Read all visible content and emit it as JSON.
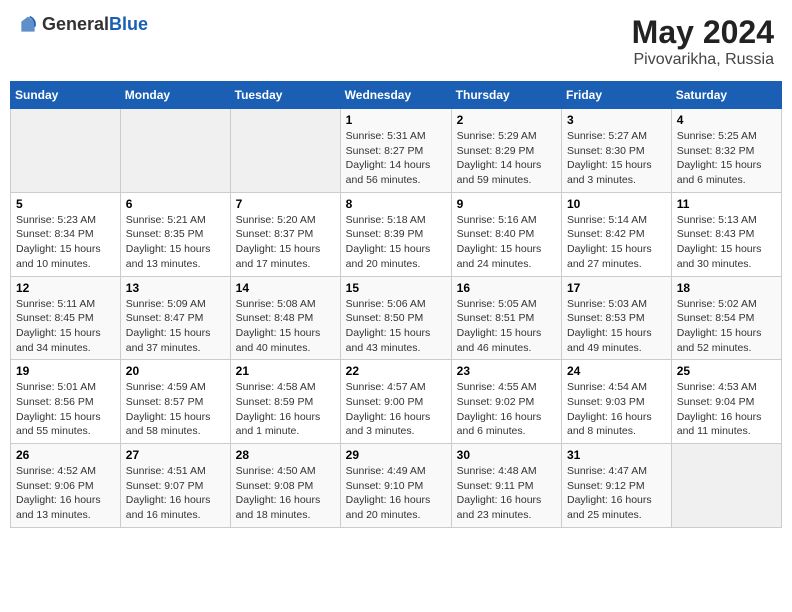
{
  "header": {
    "logo_general": "General",
    "logo_blue": "Blue",
    "title": "May 2024",
    "location": "Pivovarikha, Russia"
  },
  "weekdays": [
    "Sunday",
    "Monday",
    "Tuesday",
    "Wednesday",
    "Thursday",
    "Friday",
    "Saturday"
  ],
  "weeks": [
    [
      {
        "day": "",
        "info": ""
      },
      {
        "day": "",
        "info": ""
      },
      {
        "day": "",
        "info": ""
      },
      {
        "day": "1",
        "info": "Sunrise: 5:31 AM\nSunset: 8:27 PM\nDaylight: 14 hours\nand 56 minutes."
      },
      {
        "day": "2",
        "info": "Sunrise: 5:29 AM\nSunset: 8:29 PM\nDaylight: 14 hours\nand 59 minutes."
      },
      {
        "day": "3",
        "info": "Sunrise: 5:27 AM\nSunset: 8:30 PM\nDaylight: 15 hours\nand 3 minutes."
      },
      {
        "day": "4",
        "info": "Sunrise: 5:25 AM\nSunset: 8:32 PM\nDaylight: 15 hours\nand 6 minutes."
      }
    ],
    [
      {
        "day": "5",
        "info": "Sunrise: 5:23 AM\nSunset: 8:34 PM\nDaylight: 15 hours\nand 10 minutes."
      },
      {
        "day": "6",
        "info": "Sunrise: 5:21 AM\nSunset: 8:35 PM\nDaylight: 15 hours\nand 13 minutes."
      },
      {
        "day": "7",
        "info": "Sunrise: 5:20 AM\nSunset: 8:37 PM\nDaylight: 15 hours\nand 17 minutes."
      },
      {
        "day": "8",
        "info": "Sunrise: 5:18 AM\nSunset: 8:39 PM\nDaylight: 15 hours\nand 20 minutes."
      },
      {
        "day": "9",
        "info": "Sunrise: 5:16 AM\nSunset: 8:40 PM\nDaylight: 15 hours\nand 24 minutes."
      },
      {
        "day": "10",
        "info": "Sunrise: 5:14 AM\nSunset: 8:42 PM\nDaylight: 15 hours\nand 27 minutes."
      },
      {
        "day": "11",
        "info": "Sunrise: 5:13 AM\nSunset: 8:43 PM\nDaylight: 15 hours\nand 30 minutes."
      }
    ],
    [
      {
        "day": "12",
        "info": "Sunrise: 5:11 AM\nSunset: 8:45 PM\nDaylight: 15 hours\nand 34 minutes."
      },
      {
        "day": "13",
        "info": "Sunrise: 5:09 AM\nSunset: 8:47 PM\nDaylight: 15 hours\nand 37 minutes."
      },
      {
        "day": "14",
        "info": "Sunrise: 5:08 AM\nSunset: 8:48 PM\nDaylight: 15 hours\nand 40 minutes."
      },
      {
        "day": "15",
        "info": "Sunrise: 5:06 AM\nSunset: 8:50 PM\nDaylight: 15 hours\nand 43 minutes."
      },
      {
        "day": "16",
        "info": "Sunrise: 5:05 AM\nSunset: 8:51 PM\nDaylight: 15 hours\nand 46 minutes."
      },
      {
        "day": "17",
        "info": "Sunrise: 5:03 AM\nSunset: 8:53 PM\nDaylight: 15 hours\nand 49 minutes."
      },
      {
        "day": "18",
        "info": "Sunrise: 5:02 AM\nSunset: 8:54 PM\nDaylight: 15 hours\nand 52 minutes."
      }
    ],
    [
      {
        "day": "19",
        "info": "Sunrise: 5:01 AM\nSunset: 8:56 PM\nDaylight: 15 hours\nand 55 minutes."
      },
      {
        "day": "20",
        "info": "Sunrise: 4:59 AM\nSunset: 8:57 PM\nDaylight: 15 hours\nand 58 minutes."
      },
      {
        "day": "21",
        "info": "Sunrise: 4:58 AM\nSunset: 8:59 PM\nDaylight: 16 hours\nand 1 minute."
      },
      {
        "day": "22",
        "info": "Sunrise: 4:57 AM\nSunset: 9:00 PM\nDaylight: 16 hours\nand 3 minutes."
      },
      {
        "day": "23",
        "info": "Sunrise: 4:55 AM\nSunset: 9:02 PM\nDaylight: 16 hours\nand 6 minutes."
      },
      {
        "day": "24",
        "info": "Sunrise: 4:54 AM\nSunset: 9:03 PM\nDaylight: 16 hours\nand 8 minutes."
      },
      {
        "day": "25",
        "info": "Sunrise: 4:53 AM\nSunset: 9:04 PM\nDaylight: 16 hours\nand 11 minutes."
      }
    ],
    [
      {
        "day": "26",
        "info": "Sunrise: 4:52 AM\nSunset: 9:06 PM\nDaylight: 16 hours\nand 13 minutes."
      },
      {
        "day": "27",
        "info": "Sunrise: 4:51 AM\nSunset: 9:07 PM\nDaylight: 16 hours\nand 16 minutes."
      },
      {
        "day": "28",
        "info": "Sunrise: 4:50 AM\nSunset: 9:08 PM\nDaylight: 16 hours\nand 18 minutes."
      },
      {
        "day": "29",
        "info": "Sunrise: 4:49 AM\nSunset: 9:10 PM\nDaylight: 16 hours\nand 20 minutes."
      },
      {
        "day": "30",
        "info": "Sunrise: 4:48 AM\nSunset: 9:11 PM\nDaylight: 16 hours\nand 23 minutes."
      },
      {
        "day": "31",
        "info": "Sunrise: 4:47 AM\nSunset: 9:12 PM\nDaylight: 16 hours\nand 25 minutes."
      },
      {
        "day": "",
        "info": ""
      }
    ]
  ]
}
